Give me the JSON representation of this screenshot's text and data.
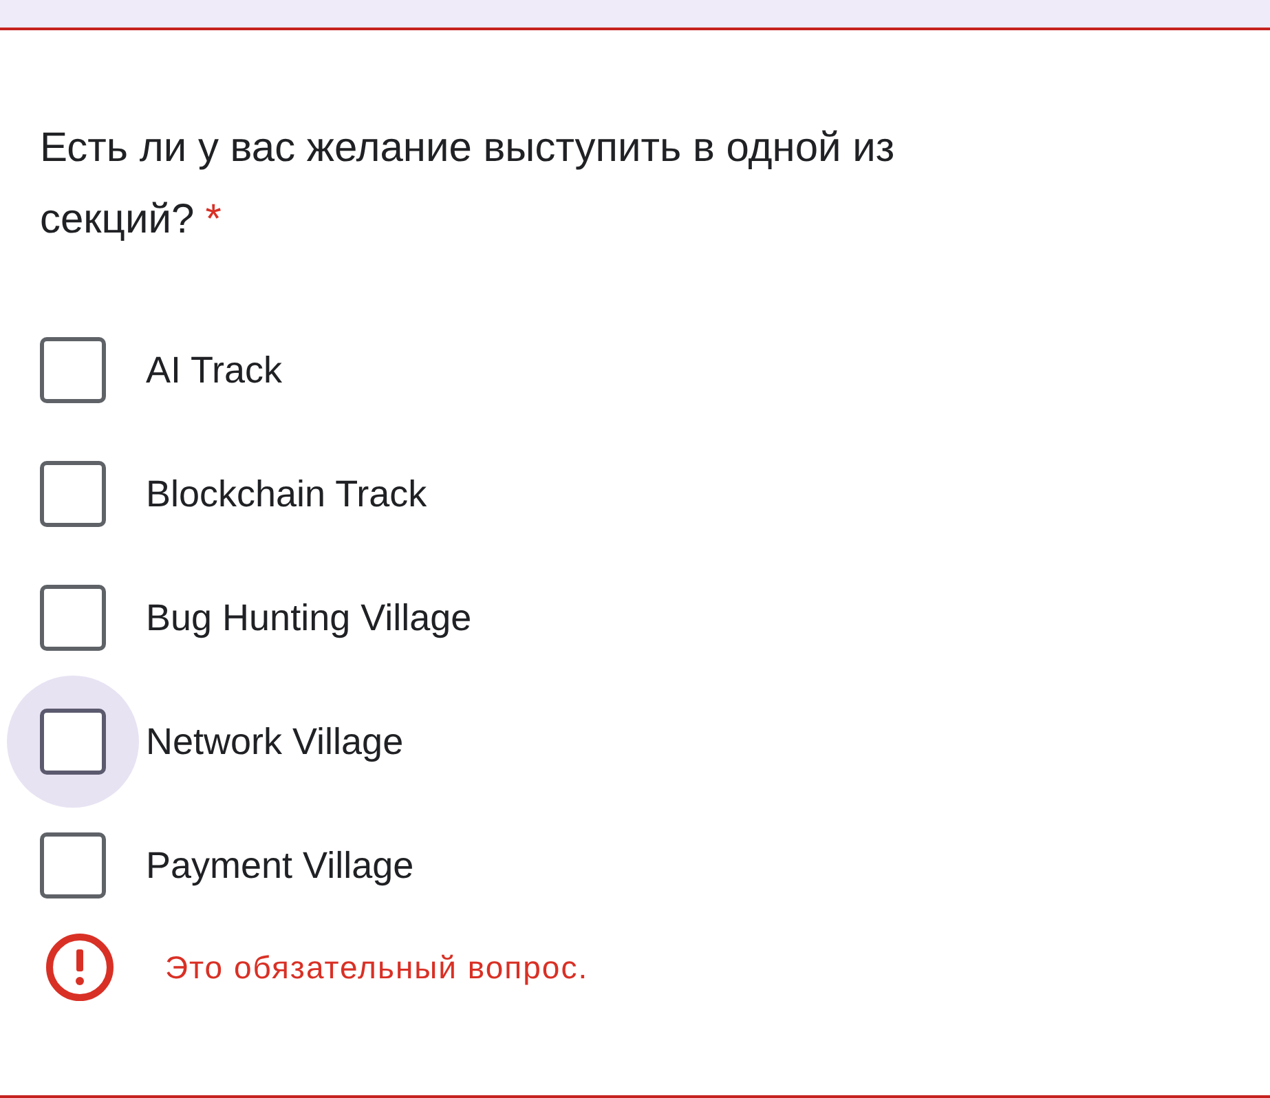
{
  "question": {
    "text": "Есть ли у вас желание выступить в одной из секций?",
    "required_mark": "*"
  },
  "options": [
    {
      "label": "AI Track",
      "checked": false,
      "focused": false
    },
    {
      "label": "Blockchain Track",
      "checked": false,
      "focused": false
    },
    {
      "label": "Bug Hunting Village",
      "checked": false,
      "focused": false
    },
    {
      "label": "Network Village",
      "checked": false,
      "focused": true
    },
    {
      "label": "Payment Village",
      "checked": false,
      "focused": false
    }
  ],
  "error": {
    "text": "Это обязательный вопрос."
  }
}
